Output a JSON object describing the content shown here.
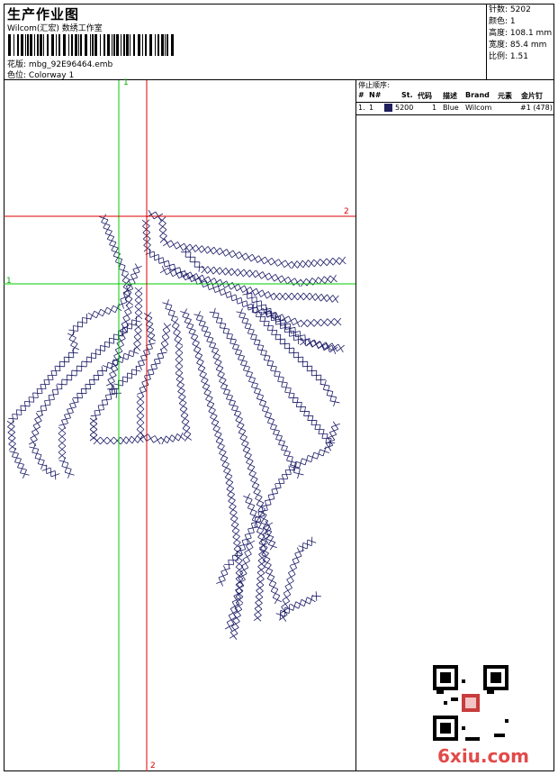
{
  "header": {
    "title": "生产作业图",
    "subtitle": "Wilcom(汇宏) 数绣工作室",
    "design_label": "花版:",
    "design_file": "mbg_92E96464.emb",
    "color_label": "色位:",
    "colorway": "Colorway 1"
  },
  "stats": [
    {
      "label": "针数:",
      "value": "5202"
    },
    {
      "label": "颜色:",
      "value": "1"
    },
    {
      "label": "高度:",
      "value": "108.1 mm"
    },
    {
      "label": "宽度:",
      "value": "85.4 mm"
    },
    {
      "label": "比例:",
      "value": "1.51"
    }
  ],
  "guides": {
    "green_label": "1",
    "red_label": "2",
    "green_color": "#00cc00",
    "red_color": "#dd0000"
  },
  "stop_sequence": {
    "title": "停止顺序:",
    "columns": [
      "#",
      "N#",
      "St.",
      "代码",
      "描述",
      "Brand",
      "元素",
      "金片钉"
    ],
    "rows": [
      {
        "num": "1.",
        "n": "1",
        "stitches": "5200",
        "code": "1",
        "desc": "Blue",
        "brand": "Wilcom",
        "element": "#1 (478)",
        "color": "#1f1f5e"
      }
    ]
  },
  "watermark": {
    "logo_text": "6xiu.com",
    "qr_icon": "qr-code-icon"
  },
  "thread_color": "#1a1a66"
}
